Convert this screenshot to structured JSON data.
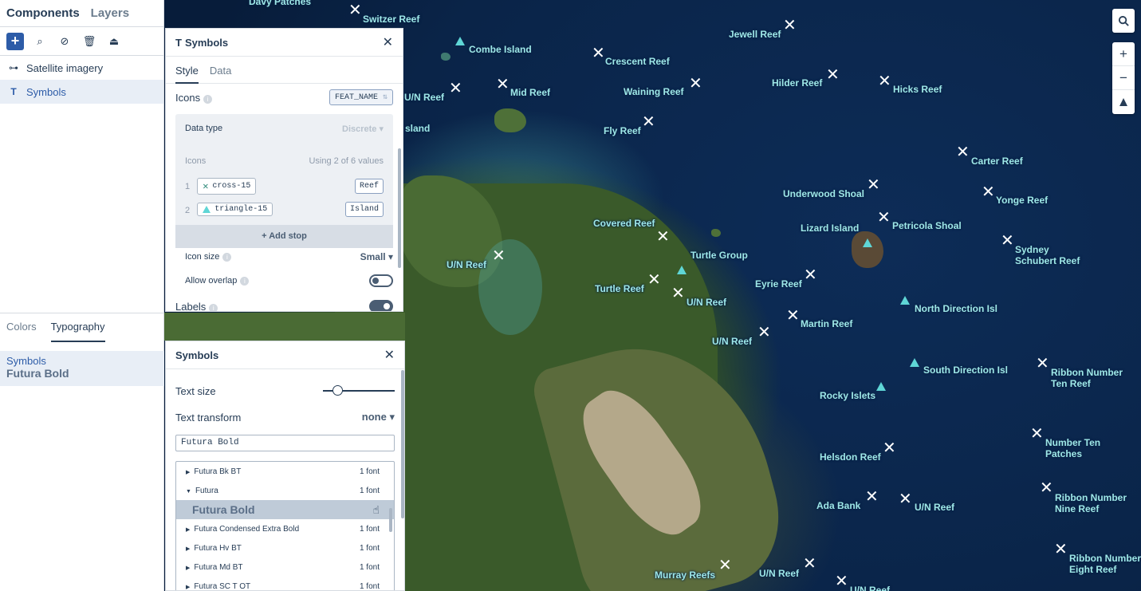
{
  "sidebar": {
    "tabs": [
      {
        "label": "Components",
        "active": true
      },
      {
        "label": "Layers",
        "active": false
      }
    ],
    "toolbar_icons": [
      "add-icon",
      "search-layers-icon",
      "hide-icon",
      "trash-icon",
      "export-icon"
    ],
    "layers": [
      {
        "label": "Satellite imagery",
        "icon": "raster-icon",
        "active": false
      },
      {
        "label": "Symbols",
        "icon": "symbol-icon",
        "active": true
      }
    ],
    "lower_tabs": [
      {
        "label": "Colors",
        "active": false
      },
      {
        "label": "Typography",
        "active": true
      }
    ],
    "typography_item": {
      "name": "Symbols",
      "font": "Futura Bold"
    }
  },
  "symbols_panel": {
    "title": "Symbols",
    "tabs": [
      {
        "label": "Style",
        "active": true
      },
      {
        "label": "Data",
        "active": false
      }
    ],
    "icons_label": "Icons",
    "icons_field": "FEAT_NAME",
    "data_type_label": "Data type",
    "data_type_value": "Discrete",
    "icons_sub_label": "Icons",
    "using_text": "Using 2 of 6 values",
    "stops": [
      {
        "index": "1",
        "icon": "cross-15",
        "value": "Reef"
      },
      {
        "index": "2",
        "icon": "triangle-15",
        "value": "Island"
      }
    ],
    "add_stop": "Add stop",
    "icon_size_label": "Icon size",
    "icon_size_value": "Small",
    "allow_overlap_label": "Allow overlap",
    "allow_overlap": false,
    "labels_label": "Labels",
    "labels_on": true
  },
  "typography_panel": {
    "title": "Symbols",
    "text_size_label": "Text size",
    "text_size_fraction": 0.2,
    "text_transform_label": "Text transform",
    "text_transform_value": "none",
    "search_value": "Futura Bold",
    "fonts": [
      {
        "name": "Futura Bk BT",
        "count": "1 font",
        "expanded": false
      },
      {
        "name": "Futura",
        "count": "1 font",
        "expanded": true
      },
      {
        "name": "Futura Bold",
        "count": "",
        "selected": true
      },
      {
        "name": "Futura Condensed Extra Bold",
        "count": "1 font",
        "expanded": false
      },
      {
        "name": "Futura Hv BT",
        "count": "1 font",
        "expanded": false
      },
      {
        "name": "Futura Md BT",
        "count": "1 font",
        "expanded": false
      },
      {
        "name": "Futura SC T OT",
        "count": "1 font",
        "expanded": false
      }
    ]
  },
  "map": {
    "labels": [
      "Davy Patches",
      "Switzer Reef",
      "Jewell Reef",
      "Combe Island",
      "Crescent Reef",
      "U/N Reef",
      "Mid Reef",
      "Waining Reef",
      "Hilder Reef",
      "Hicks Reef",
      "sland",
      "Fly Reef",
      "Carter Reef",
      "Underwood Shoal",
      "Yonge Reef",
      "Covered Reef",
      "Lizard Island",
      "Petricola Shoal",
      "Sydney",
      "Schubert Reef",
      "U/N Reef",
      "Turtle Group",
      "Turtle Reef",
      "U/N Reef",
      "Eyrie Reef",
      "North Direction Isl",
      "Martin Reef",
      "U/N Reef",
      "South Direction Isl",
      "Ribbon Number",
      "Ten Reef",
      "Rocky Islets",
      "Helsdon Reef",
      "Number Ten",
      "Patches",
      "Ada Bank",
      "U/N Reef",
      "Ribbon Number",
      "Nine Reef",
      "Murray Reefs",
      "U/N Reef",
      "Ribbon Number",
      "Eight Reef",
      "U/N Reef"
    ],
    "controls": [
      "search-icon",
      "zoom-in-icon",
      "zoom-out-icon",
      "compass-icon"
    ]
  }
}
